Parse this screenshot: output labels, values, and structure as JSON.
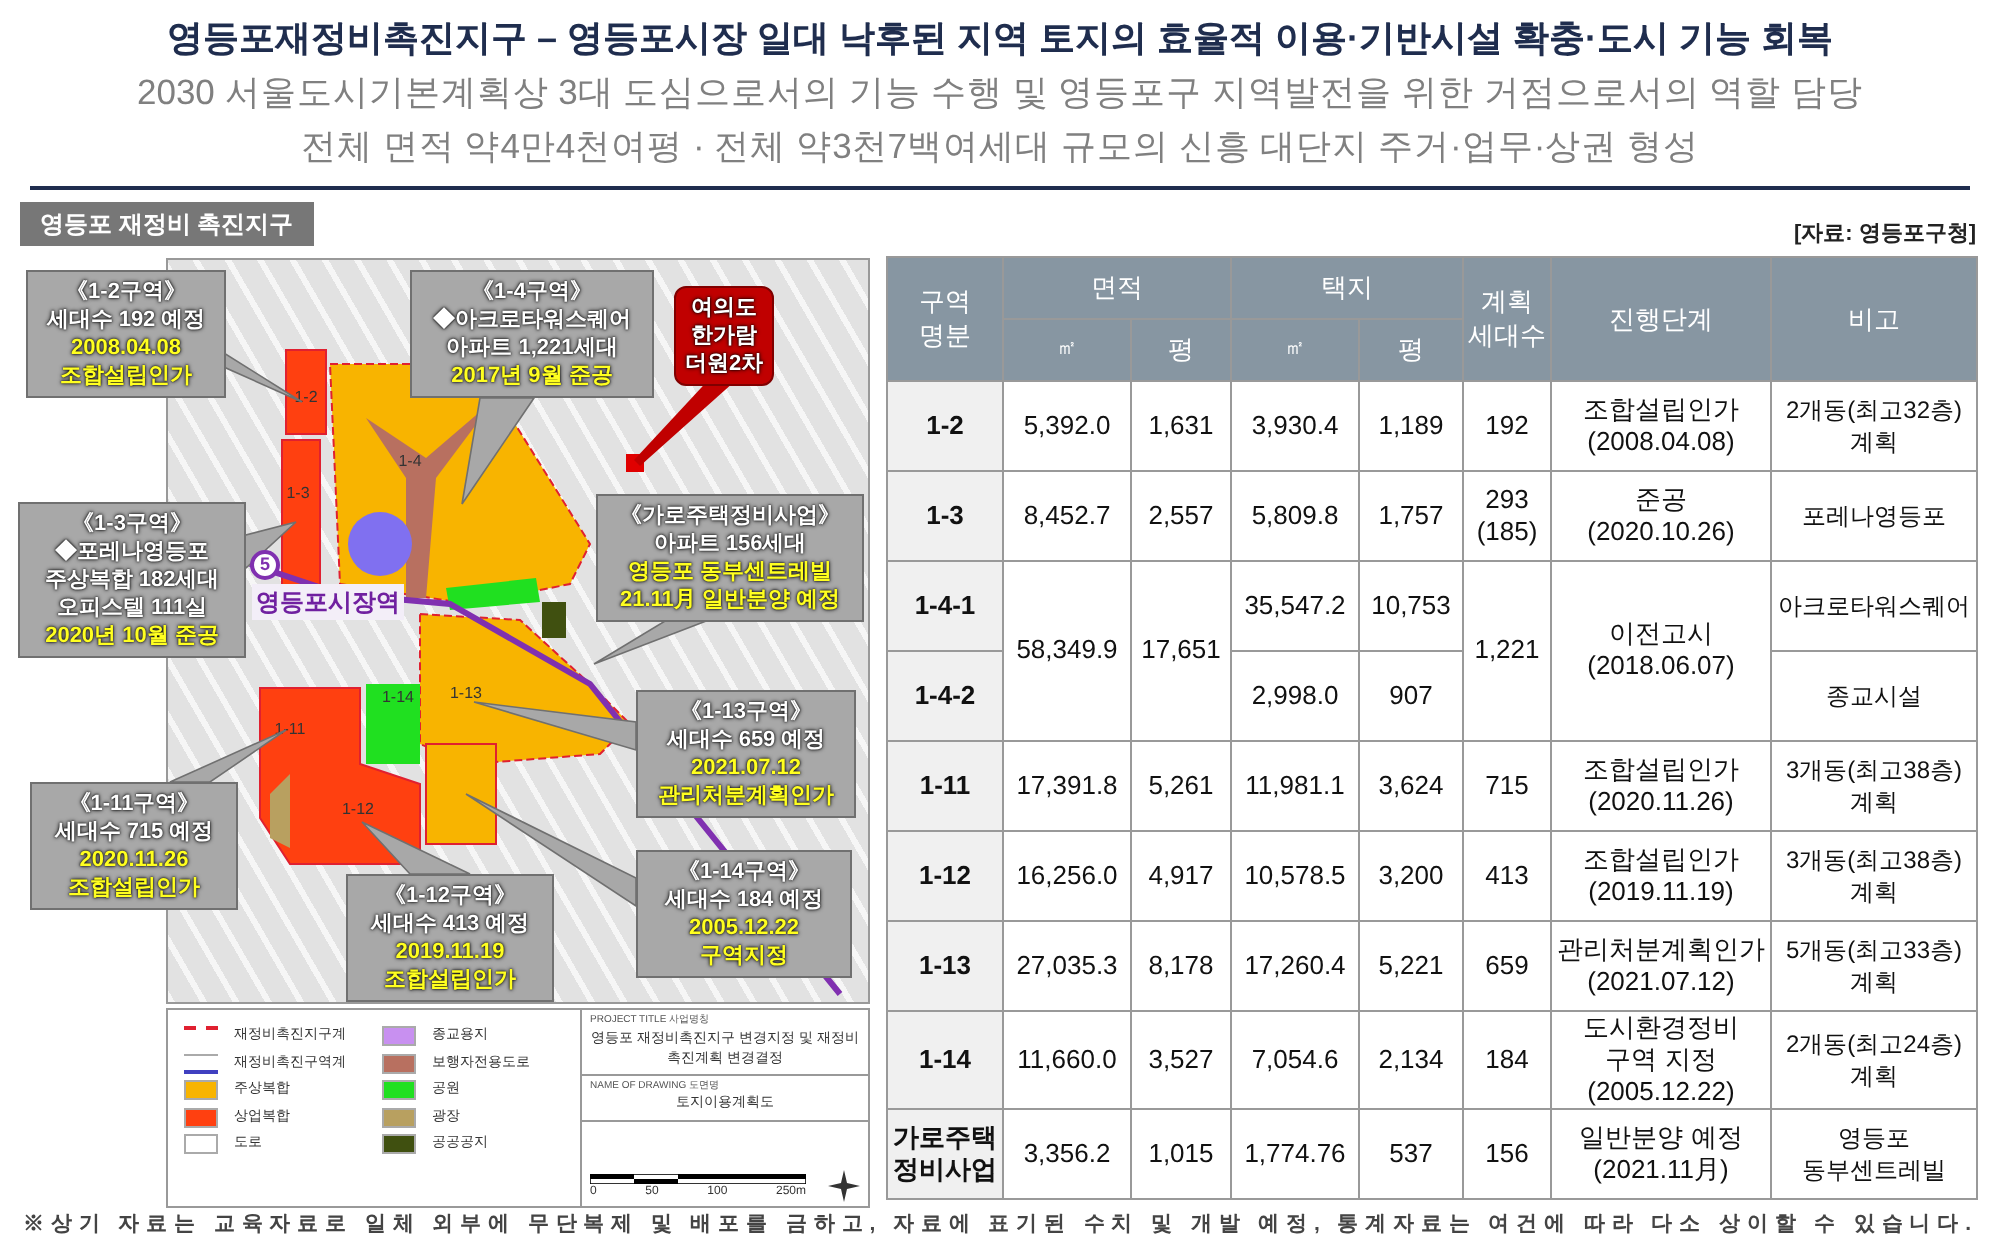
{
  "header": {
    "title": "영등포재정비촉진지구 – 영등포시장 일대 낙후된 지역 토지의 효율적 이용·기반시설 확충·도시 기능 회복",
    "subtitle_lines": [
      "2030 서울도시기본계획상 3대 도심으로서의 기능 수행 및 영등포구 지역발전을 위한 거점으로서의 역할 담당",
      "전체 면적 약4만4천여평 · 전체 약3천7백여세대 규모의 신흥 대단지 주거·업무·상권 형성"
    ]
  },
  "map_panel": {
    "tab": "영등포 재정비 촉진지구",
    "zone_labels": [
      "1-2",
      "1-3",
      "1-4",
      "1-13",
      "1-11",
      "1-14",
      "1-12"
    ],
    "station": {
      "line": "5",
      "name": "영등포시장역"
    },
    "callouts": [
      {
        "kind": "gray",
        "lines": [
          {
            "text": "《1-2구역》",
            "highlight": false
          },
          {
            "text": "세대수 192 예정",
            "highlight": false
          },
          {
            "text": "2008.04.08",
            "highlight": true
          },
          {
            "text": "조합설립인가",
            "highlight": true
          }
        ]
      },
      {
        "kind": "gray",
        "lines": [
          {
            "text": "《1-4구역》",
            "highlight": false
          },
          {
            "text": "◆아크로타워스퀘어",
            "highlight": false
          },
          {
            "text": "아파트 1,221세대",
            "highlight": false
          },
          {
            "text": "2017년 9월 준공",
            "highlight": true
          }
        ]
      },
      {
        "kind": "red",
        "lines": [
          {
            "text": "여의도",
            "highlight": false
          },
          {
            "text": "한가람",
            "highlight": false
          },
          {
            "text": "더원2차",
            "highlight": false
          }
        ]
      },
      {
        "kind": "gray",
        "lines": [
          {
            "text": "《1-3구역》",
            "highlight": false
          },
          {
            "text": "◆포레나영등포",
            "highlight": false
          },
          {
            "text": "주상복합 182세대",
            "highlight": false
          },
          {
            "text": "오피스텔 111실",
            "highlight": false
          },
          {
            "text": "2020년 10월 준공",
            "highlight": true
          }
        ]
      },
      {
        "kind": "gray",
        "lines": [
          {
            "text": "《가로주택정비사업》",
            "highlight": false
          },
          {
            "text": "아파트 156세대",
            "highlight": false
          },
          {
            "text": "영등포 동부센트레빌",
            "highlight": true
          },
          {
            "text": "21.11月 일반분양 예정",
            "highlight": true
          }
        ]
      },
      {
        "kind": "gray",
        "lines": [
          {
            "text": "《1-13구역》",
            "highlight": false
          },
          {
            "text": "세대수 659 예정",
            "highlight": false
          },
          {
            "text": "2021.07.12",
            "highlight": true
          },
          {
            "text": "관리처분계획인가",
            "highlight": true
          }
        ]
      },
      {
        "kind": "gray",
        "lines": [
          {
            "text": "《1-11구역》",
            "highlight": false
          },
          {
            "text": "세대수 715 예정",
            "highlight": false
          },
          {
            "text": "2020.11.26",
            "highlight": true
          },
          {
            "text": "조합설립인가",
            "highlight": true
          }
        ]
      },
      {
        "kind": "gray",
        "lines": [
          {
            "text": "《1-12구역》",
            "highlight": false
          },
          {
            "text": "세대수 413 예정",
            "highlight": false
          },
          {
            "text": "2019.11.19",
            "highlight": true
          },
          {
            "text": "조합설립인가",
            "highlight": true
          }
        ]
      },
      {
        "kind": "gray",
        "lines": [
          {
            "text": "《1-14구역》",
            "highlight": false
          },
          {
            "text": "세대수 184 예정",
            "highlight": false
          },
          {
            "text": "2005.12.22",
            "highlight": true
          },
          {
            "text": "구역지정",
            "highlight": true
          }
        ]
      }
    ],
    "legend": {
      "items": [
        {
          "label": "재정비촉진지구계",
          "kind": "dashed",
          "color": "#e02030"
        },
        {
          "label": "종교용지",
          "kind": "fill",
          "color": "#c890f0"
        },
        {
          "label": "재정비촉진구역계",
          "kind": "line",
          "color": "#4040c0"
        },
        {
          "label": "보행자전용도로",
          "kind": "fill",
          "color": "#b87060"
        },
        {
          "label": "주상복합",
          "kind": "fill",
          "color": "#f8b400"
        },
        {
          "label": "공원",
          "kind": "fill",
          "color": "#20e020"
        },
        {
          "label": "상업복합",
          "kind": "fill",
          "color": "#ff4010"
        },
        {
          "label": "광장",
          "kind": "fill",
          "color": "#b8a060"
        },
        {
          "label": "도로",
          "kind": "fill",
          "color": "#ffffff"
        },
        {
          "label": "공공공지",
          "kind": "fill",
          "color": "#405010"
        }
      ],
      "project_title_label": "PROJECT TITLE 사업명칭",
      "project_title": "영등포 재정비촉진지구 변경지정 및 재정비촉진계획 변경결정",
      "drawing_name_label": "NAME OF DRAWING 도면명",
      "drawing_name": "토지이용계획도",
      "scale_ticks": [
        "0",
        "50",
        "100",
        "250m"
      ]
    }
  },
  "table": {
    "source": "[자료: 영등포구청]",
    "header": {
      "district": "구역\n명분",
      "area": "면적",
      "site": "택지",
      "area_m2": "㎡",
      "area_pyeong": "평",
      "site_m2": "㎡",
      "site_pyeong": "평",
      "households": "계획\n세대수",
      "stage": "진행단계",
      "note": "비고"
    },
    "rows": [
      {
        "district": "1-2",
        "area_m2": "5,392.0",
        "area_pyeong": "1,631",
        "site_m2": "3,930.4",
        "site_pyeong": "1,189",
        "households": "192",
        "stage": "조합설립인가\n(2008.04.08)",
        "note": "2개동(최고32층)\n계획"
      },
      {
        "district": "1-3",
        "area_m2": "8,452.7",
        "area_pyeong": "2,557",
        "site_m2": "5,809.8",
        "site_pyeong": "1,757",
        "households": "293\n(185)",
        "stage": "준공\n(2020.10.26)",
        "note": "포레나영등포"
      },
      {
        "district": "1-4-1",
        "area_m2": "58,349.9",
        "area_pyeong": "17,651",
        "site_m2": "35,547.2",
        "site_pyeong": "10,753",
        "households": "1,221",
        "stage": "이전고시\n(2018.06.07)",
        "note": "아크로타워스퀘어"
      },
      {
        "district": "1-4-2",
        "site_m2": "2,998.0",
        "site_pyeong": "907",
        "note": "종교시설"
      },
      {
        "district": "1-11",
        "area_m2": "17,391.8",
        "area_pyeong": "5,261",
        "site_m2": "11,981.1",
        "site_pyeong": "3,624",
        "households": "715",
        "stage": "조합설립인가\n(2020.11.26)",
        "note": "3개동(최고38층)\n계획"
      },
      {
        "district": "1-12",
        "area_m2": "16,256.0",
        "area_pyeong": "4,917",
        "site_m2": "10,578.5",
        "site_pyeong": "3,200",
        "households": "413",
        "stage": "조합설립인가\n(2019.11.19)",
        "note": "3개동(최고38층)\n계획"
      },
      {
        "district": "1-13",
        "area_m2": "27,035.3",
        "area_pyeong": "8,178",
        "site_m2": "17,260.4",
        "site_pyeong": "5,221",
        "households": "659",
        "stage": "관리처분계획인가\n(2021.07.12)",
        "note": "5개동(최고33층)\n계획"
      },
      {
        "district": "1-14",
        "area_m2": "11,660.0",
        "area_pyeong": "3,527",
        "site_m2": "7,054.6",
        "site_pyeong": "2,134",
        "households": "184",
        "stage": "도시환경정비\n구역 지정\n(2005.12.22)",
        "note": "2개동(최고24층)\n계획"
      },
      {
        "district": "가로주택\n정비사업",
        "area_m2": "3,356.2",
        "area_pyeong": "1,015",
        "site_m2": "1,774.76",
        "site_pyeong": "537",
        "households": "156",
        "stage": "일반분양 예정\n(2021.11月)",
        "note": "영등포\n동부센트레빌"
      }
    ]
  },
  "footnote": "※상기 자료는 교육자료로 일체 외부에 무단복제 및 배포를 금하고, 자료에 표기된 수치 및 개발 예정, 통계자료는 여건에 따라 다소 상이할 수 있습니다."
}
